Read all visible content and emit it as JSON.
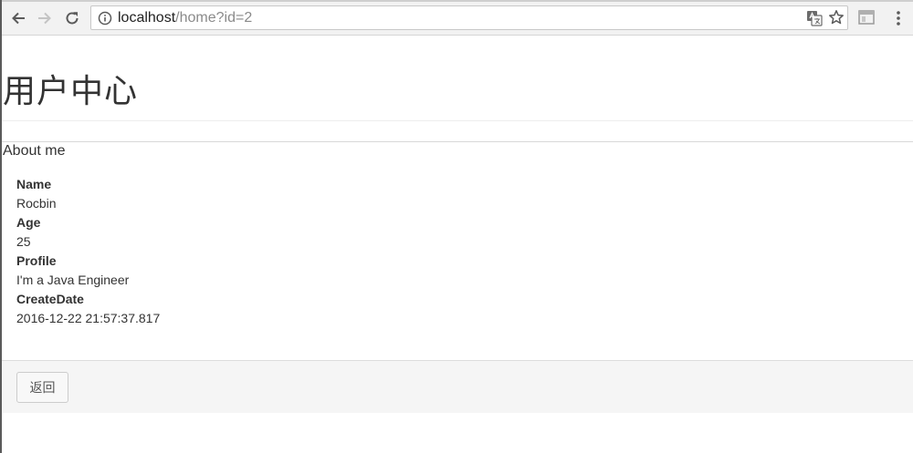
{
  "browser": {
    "url_host": "localhost",
    "url_path": "/home?id=2",
    "icons": [
      "back-arrow-icon",
      "forward-arrow-icon",
      "reload-icon",
      "info-icon",
      "translate-icon",
      "star-icon",
      "extension-icon",
      "menu-icon"
    ]
  },
  "page": {
    "title": "用户中心"
  },
  "panel": {
    "heading": "About me",
    "fields": [
      {
        "label": "Name",
        "value": "Rocbin"
      },
      {
        "label": "Age",
        "value": "25"
      },
      {
        "label": "Profile",
        "value": "I'm a Java Engineer"
      },
      {
        "label": "CreateDate",
        "value": "2016-12-22 21:57:37.817"
      }
    ],
    "back_label": "返回"
  }
}
